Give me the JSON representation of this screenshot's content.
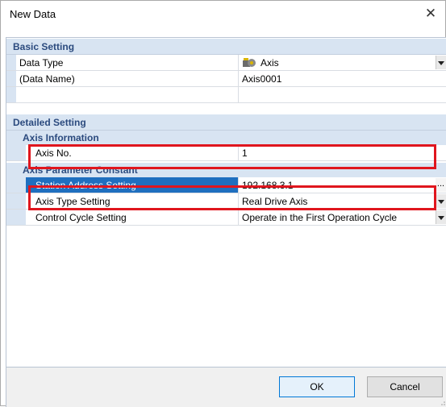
{
  "window": {
    "title": "New Data",
    "close_glyph": "✕"
  },
  "basic_setting": {
    "header": "Basic Setting",
    "rows": [
      {
        "label": "Data Type",
        "value": "Axis",
        "icon": "axis-icon",
        "control": "dropdown"
      },
      {
        "label": "(Data Name)",
        "value": "Axis0001"
      },
      {
        "label": "",
        "value": ""
      }
    ]
  },
  "detailed_setting": {
    "header": "Detailed Setting",
    "axis_information": {
      "header": "Axis Information",
      "rows": [
        {
          "label": "Axis No.",
          "value": "1"
        }
      ]
    },
    "axis_parameter_constant": {
      "header": "Axis Parameter Constant",
      "rows": [
        {
          "label": "Station Address Setting",
          "value": "192.168.3.1",
          "control": "ellipsis",
          "selected": true
        },
        {
          "label": "Axis Type Setting",
          "value": "Real Drive Axis",
          "control": "dropdown"
        },
        {
          "label": "Control Cycle Setting",
          "value": "Operate in the First Operation Cycle",
          "control": "dropdown"
        }
      ]
    }
  },
  "buttons": {
    "ok": "OK",
    "cancel": "Cancel",
    "ellipsis": "..."
  },
  "colors": {
    "highlight": "#e0161e",
    "selection": "#1f6fbf",
    "section_bg": "#d8e4f2",
    "section_text": "#2b4a7e"
  }
}
